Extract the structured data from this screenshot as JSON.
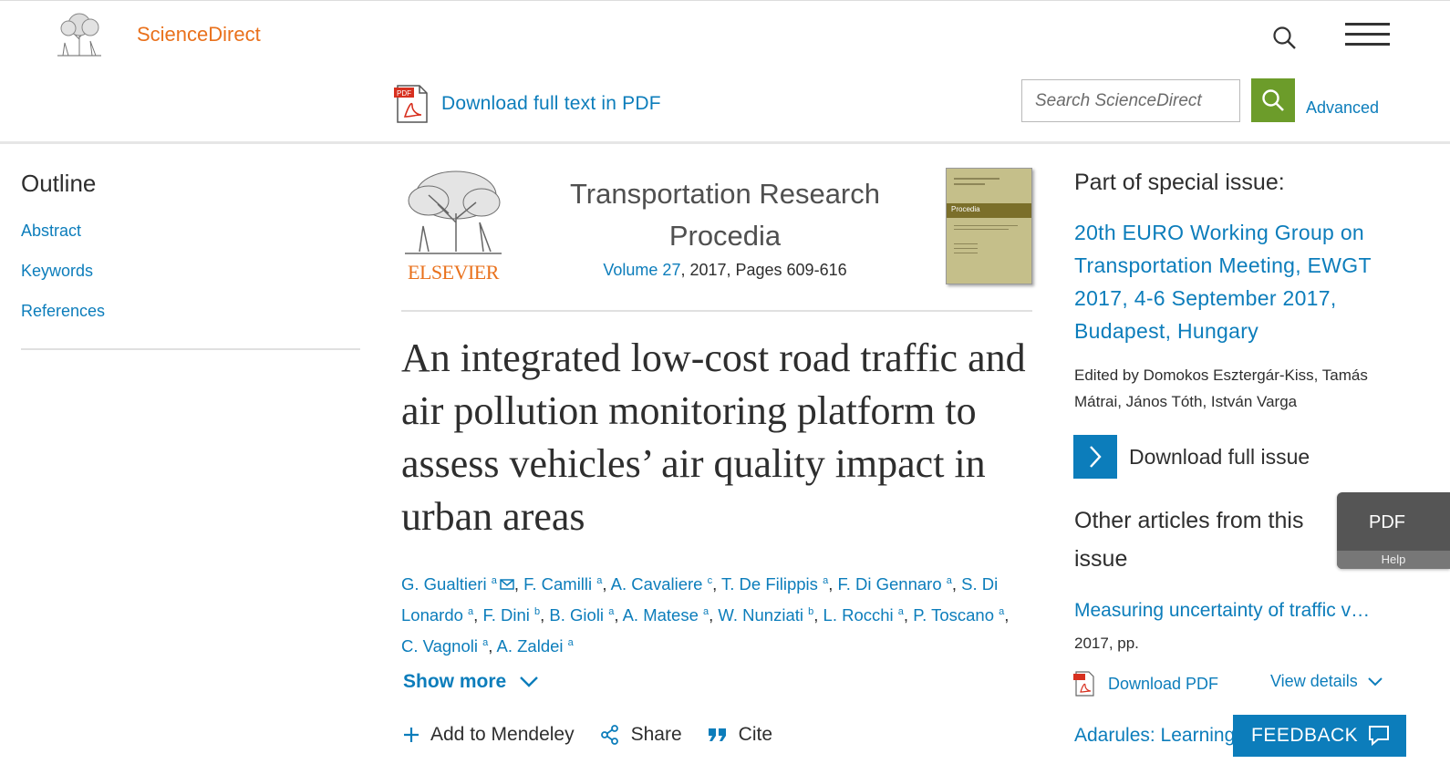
{
  "header": {
    "brand": "ScienceDirect",
    "download_pdf_label": "Download full text in PDF",
    "search_placeholder": "Search ScienceDirect",
    "advanced_label": "Advanced",
    "pdf_badge": "PDF"
  },
  "outline": {
    "title": "Outline",
    "links": [
      "Abstract",
      "Keywords",
      "References"
    ]
  },
  "journal": {
    "publisher_wordmark": "ELSEVIER",
    "title": "Transportation Research Procedia",
    "volume_link": "Volume 27",
    "meta_rest": ", 2017, Pages 609-616",
    "cover_band_text": "Procedia"
  },
  "article": {
    "title": "An integrated low-cost road traffic and air pollution monitoring platform to assess vehicles’ air quality impact in urban areas",
    "authors": [
      {
        "name": "G. Gualtieri",
        "sup": "a",
        "email": true
      },
      {
        "name": "F. Camilli",
        "sup": "a"
      },
      {
        "name": "A. Cavaliere",
        "sup": "c"
      },
      {
        "name": "T. De Filippis",
        "sup": "a"
      },
      {
        "name": "F. Di Gennaro",
        "sup": "a"
      },
      {
        "name": "S. Di Lonardo",
        "sup": "a"
      },
      {
        "name": "F. Dini",
        "sup": "b"
      },
      {
        "name": "B. Gioli",
        "sup": "a"
      },
      {
        "name": "A. Matese",
        "sup": "a"
      },
      {
        "name": "W. Nunziati",
        "sup": "b"
      },
      {
        "name": "L. Rocchi",
        "sup": "a"
      },
      {
        "name": "P. Toscano",
        "sup": "a"
      },
      {
        "name": "C. Vagnoli",
        "sup": "a"
      },
      {
        "name": "A. Zaldei",
        "sup": "a"
      }
    ],
    "show_more": "Show more",
    "actions": {
      "mendeley": "Add to Mendeley",
      "share": "Share",
      "cite": "Cite"
    }
  },
  "special_issue": {
    "label": "Part of special issue:",
    "title": "20th EURO Working Group on Transportation Meeting, EWGT 2017, 4-6 September 2017, Budapest, Hungary",
    "editors": "Edited by Domokos Esztergár-Kiss, Tamás Mátrai, János Tóth, István Varga",
    "download_full_issue": "Download full issue"
  },
  "other_articles": {
    "heading": "Other articles from this issue",
    "items": [
      {
        "title": "Measuring uncertainty of traffic v…",
        "meta": "2017, pp.",
        "pdf": "Download PDF",
        "details": "View details"
      },
      {
        "title": "Adarules: Learning"
      }
    ]
  },
  "floating": {
    "pdf": "PDF",
    "help": "Help",
    "feedback": "FEEDBACK"
  },
  "colors": {
    "brand_orange": "#e9711c",
    "link_blue": "#0c7dbb",
    "search_green": "#6c9c2a"
  }
}
